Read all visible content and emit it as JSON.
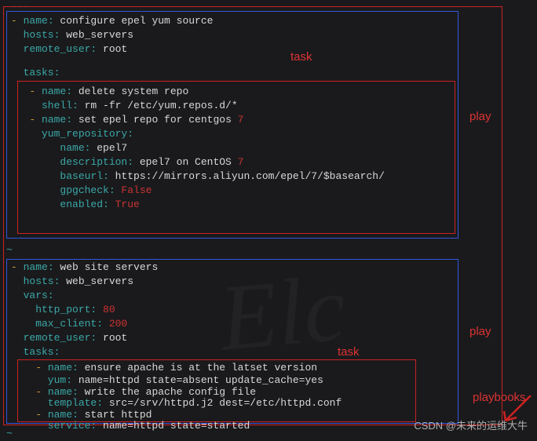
{
  "labels": {
    "task1": "task",
    "task2": "task",
    "play1": "play",
    "play2": "play",
    "playbooks": "playbooks"
  },
  "dashes": "---",
  "lines": {
    "l1_dash": "-",
    "l1_key": " name:",
    "l1_val": " configure epel yum source",
    "l2_key": "  hosts:",
    "l2_val": " web_servers",
    "l3_key": "  remote_user:",
    "l3_val": " root",
    "l4_key": "  tasks:",
    "l5_dash": "   -",
    "l5_key": " name:",
    "l5_val": " delete system repo",
    "l6_key": "     shell:",
    "l6_val": " rm -fr /etc/yum.repos.d/*",
    "l7_dash": "   -",
    "l7_key": " name:",
    "l7_val1": " set epel repo for centgos ",
    "l7_val2": "7",
    "l8_key": "     yum_repository:",
    "l9_key": "        name:",
    "l9_val": " epel7",
    "l10_key": "        description:",
    "l10_val1": " epel7 on CentOS ",
    "l10_val2": "7",
    "l11_key": "        baseurl:",
    "l11_val": " https://mirrors.aliyun.com/epel/7/$basearch/",
    "l12_key": "        gpgcheck:",
    "l12_val": " False",
    "l13_key": "        enabled:",
    "l13_val": " True",
    "p2l1_dash": "-",
    "p2l1_key": " name:",
    "p2l1_val": " web site servers",
    "p2l2_key": "  hosts:",
    "p2l2_val": " web_servers",
    "p2l3_key": "  vars:",
    "p2l4_key": "    http_port:",
    "p2l4_val": " 80",
    "p2l5_key": "    max_client:",
    "p2l5_val": " 200",
    "p2l6_key": "  remote_user:",
    "p2l6_val": " root",
    "p2l7_key": "  tasks:",
    "p2t1_dash": "    -",
    "p2t1_key": " name:",
    "p2t1_val": " ensure apache is at the latset version",
    "p2t2_key": "      yum:",
    "p2t2_val": " name=httpd state=absent update_cache=yes",
    "p2t3_dash": "    -",
    "p2t3_key": " name:",
    "p2t3_val": " write the apache config file",
    "p2t4_key": "      template:",
    "p2t4_val": " src=/srv/httpd.j2 dest=/etc/httpd.conf",
    "p2t5_dash": "    -",
    "p2t5_key": " name:",
    "p2t5_val": " start httpd",
    "p2t6_key": "      service:",
    "p2t6_val": " name=httpd state=started"
  },
  "tilde": "~",
  "watermark": "CSDN @未来的运维大牛"
}
